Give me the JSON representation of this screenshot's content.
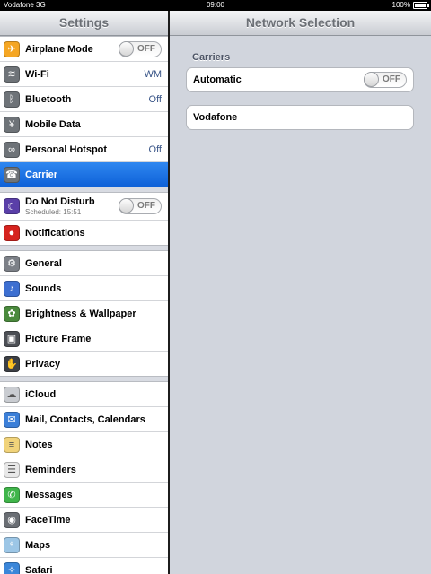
{
  "status_bar": {
    "carrier": "Vodafone 3G",
    "time": "09:00",
    "battery": "100%",
    "battery_level": 1.0
  },
  "master": {
    "title": "Settings",
    "groups": [
      [
        {
          "label": "Airplane Mode",
          "icon": "airplane-icon",
          "icon_color": "#f5a623",
          "switch": "OFF"
        },
        {
          "label": "Wi-Fi",
          "icon": "wifi-icon",
          "icon_color": "#6e7378",
          "value": "WM"
        },
        {
          "label": "Bluetooth",
          "icon": "bluetooth-icon",
          "icon_color": "#6e7378",
          "value": "Off"
        },
        {
          "label": "Mobile Data",
          "icon": "antenna-icon",
          "icon_color": "#6e7378"
        },
        {
          "label": "Personal Hotspot",
          "icon": "link-icon",
          "icon_color": "#6e7378",
          "value": "Off"
        },
        {
          "label": "Carrier",
          "icon": "phone-icon",
          "icon_color": "#6e7378",
          "selected": true
        }
      ],
      [
        {
          "label": "Do Not Disturb",
          "sub": "Scheduled: 15:51",
          "icon": "moon-icon",
          "icon_color": "#5a3fa8",
          "switch": "OFF"
        },
        {
          "label": "Notifications",
          "icon": "notifications-icon",
          "icon_color": "#d6231e"
        }
      ],
      [
        {
          "label": "General",
          "icon": "gear-icon",
          "icon_color": "#7c8087"
        },
        {
          "label": "Sounds",
          "icon": "speaker-icon",
          "icon_color": "#3d6fd1"
        },
        {
          "label": "Brightness & Wallpaper",
          "icon": "flower-icon",
          "icon_color": "#4a8a3d"
        },
        {
          "label": "Picture Frame",
          "icon": "picture-frame-icon",
          "icon_color": "#4c4f55"
        },
        {
          "label": "Privacy",
          "icon": "hand-icon",
          "icon_color": "#3c3f45"
        }
      ],
      [
        {
          "label": "iCloud",
          "icon": "cloud-icon",
          "icon_color": "#c9ccd1"
        },
        {
          "label": "Mail, Contacts, Calendars",
          "icon": "mail-icon",
          "icon_color": "#3b7fd8"
        },
        {
          "label": "Notes",
          "icon": "notes-icon",
          "icon_color": "#f1d37a"
        },
        {
          "label": "Reminders",
          "icon": "reminders-icon",
          "icon_color": "#e8e8e8"
        },
        {
          "label": "Messages",
          "icon": "messages-icon",
          "icon_color": "#3fb54a"
        },
        {
          "label": "FaceTime",
          "icon": "facetime-icon",
          "icon_color": "#6a6e74"
        },
        {
          "label": "Maps",
          "icon": "maps-icon",
          "icon_color": "#9cc6e6"
        },
        {
          "label": "Safari",
          "icon": "compass-icon",
          "icon_color": "#3a86d9"
        }
      ]
    ]
  },
  "detail": {
    "title": "Network Selection",
    "section": "Carriers",
    "automatic_label": "Automatic",
    "automatic_switch": "OFF",
    "carrier_name": "Vodafone"
  }
}
